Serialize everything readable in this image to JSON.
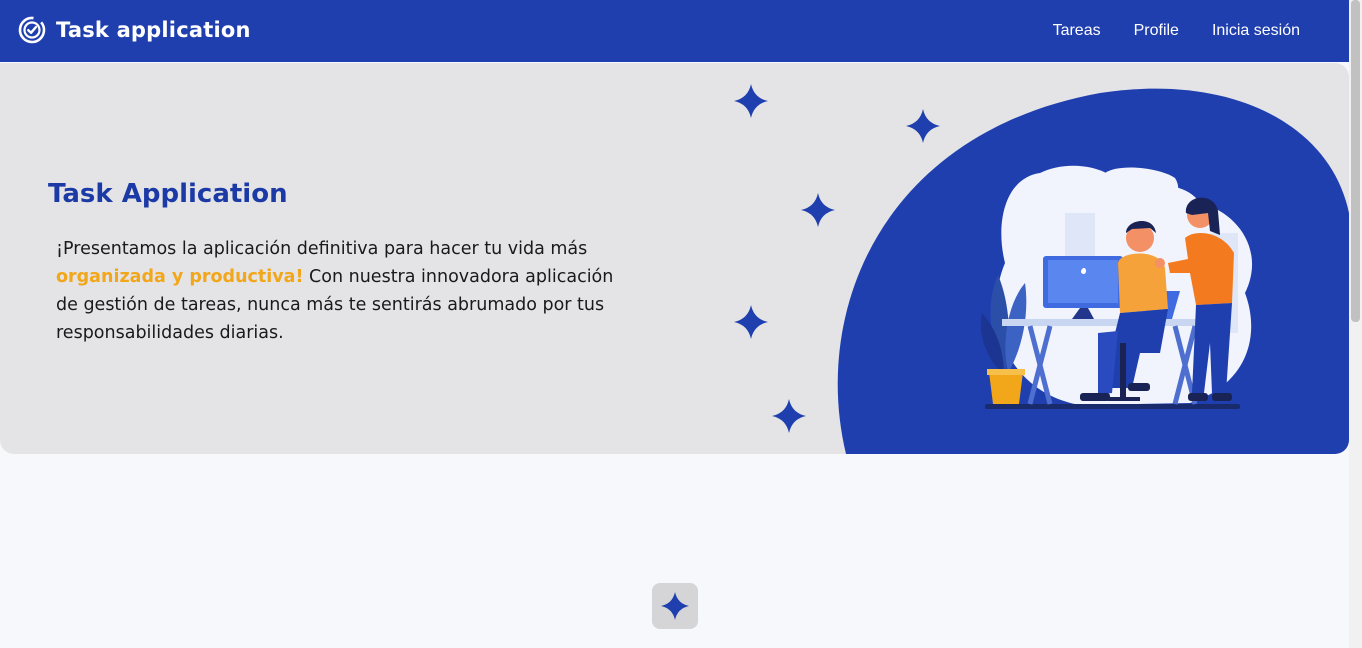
{
  "navbar": {
    "brand_name": "Task application",
    "brand_icon": "check-badge-icon",
    "links": [
      {
        "label": "Tareas"
      },
      {
        "label": "Profile"
      },
      {
        "label": "Inicia sesión"
      }
    ]
  },
  "hero": {
    "title": "Task Application",
    "text_before": "¡Presentamos la aplicación definitiva para hacer tu vida más ",
    "highlight": "organizada y productiva!",
    "text_after": " Con nuestra innovadora aplicación de gestión de tareas, nunca más te sentirás abrumado por tus responsabilidades diarias.",
    "illustration": "people-working-at-desk-illustration",
    "decoration_icon": "sparkle-star-icon"
  },
  "bottom": {
    "button_icon": "sparkle-star-icon"
  },
  "colors": {
    "primary": "#1f3faf",
    "hero_background": "#e4e4e6",
    "highlight": "#f2a61a",
    "page_background": "#f7f8fb"
  }
}
